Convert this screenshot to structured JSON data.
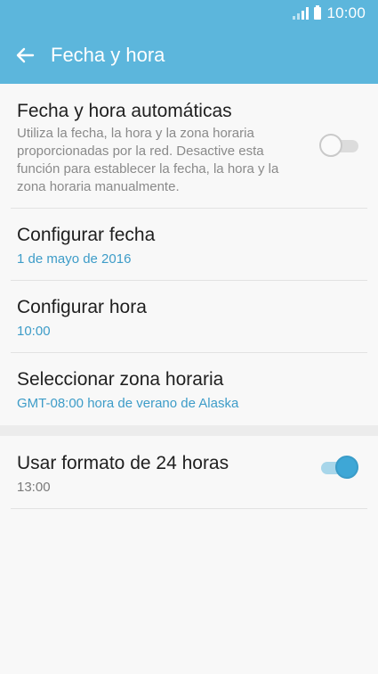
{
  "status_bar": {
    "time": "10:00"
  },
  "app_bar": {
    "title": "Fecha y hora"
  },
  "settings": {
    "auto_datetime": {
      "title": "Fecha y hora automáticas",
      "description": "Utiliza la fecha, la hora y la zona horaria proporcionadas por la red. Desactive esta función para establecer la fecha, la hora y la zona horaria manualmente.",
      "enabled": false
    },
    "set_date": {
      "title": "Configurar fecha",
      "value": "1 de mayo de 2016"
    },
    "set_time": {
      "title": "Configurar hora",
      "value": "10:00"
    },
    "time_zone": {
      "title": "Seleccionar zona horaria",
      "value": "GMT-08:00 hora de verano de Alaska"
    },
    "format_24h": {
      "title": "Usar formato de 24 horas",
      "value": "13:00",
      "enabled": true
    }
  },
  "colors": {
    "app_bar": "#5cb6dc",
    "accent": "#3d9cc8",
    "switch_on": "#3ea7d6"
  }
}
